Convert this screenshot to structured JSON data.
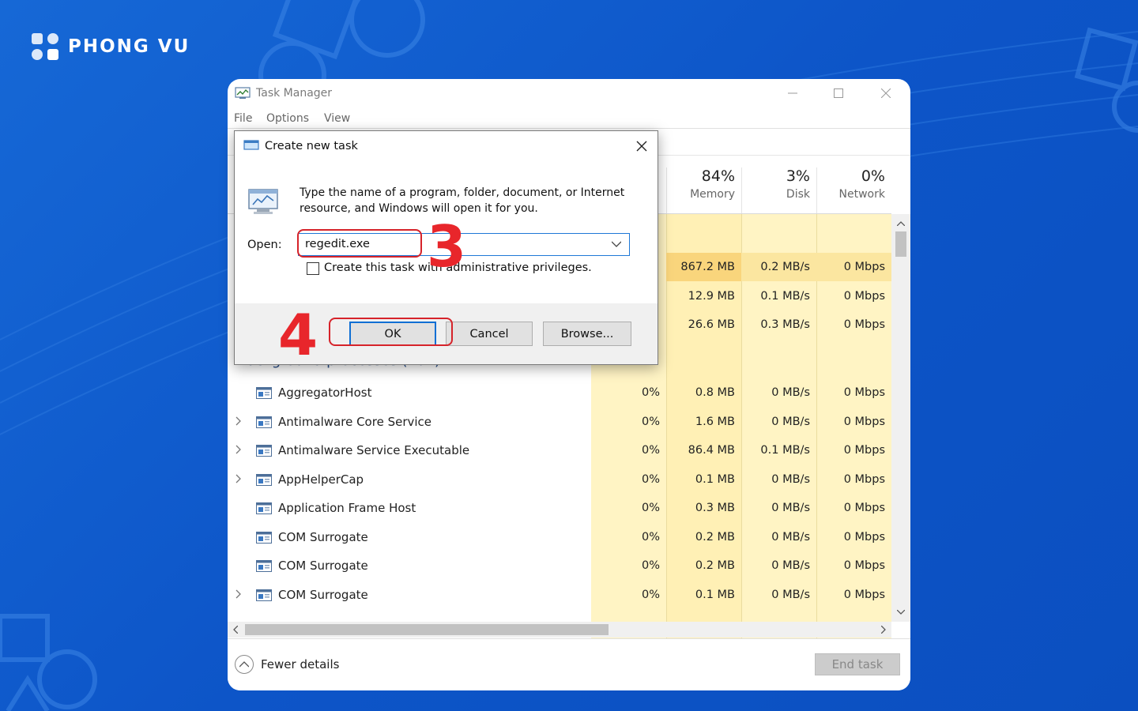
{
  "brand": {
    "name": "PHONG VU"
  },
  "window": {
    "title": "Task Manager",
    "menu": [
      "File",
      "Options",
      "View"
    ]
  },
  "columns": [
    {
      "pct": "84%",
      "name": "Memory"
    },
    {
      "pct": "3%",
      "name": "Disk"
    },
    {
      "pct": "0%",
      "name": "Network"
    }
  ],
  "top_rows": [
    {
      "mem": "867.2 MB",
      "disk": "0.2 MB/s",
      "net": "0 Mbps"
    },
    {
      "mem": "12.9 MB",
      "disk": "0.1 MB/s",
      "net": "0 Mbps"
    },
    {
      "mem": "26.6 MB",
      "disk": "0.3 MB/s",
      "net": "0 Mbps"
    }
  ],
  "section_label": "Background processes (102)",
  "processes": [
    {
      "name": "AggregatorHost",
      "expand": false,
      "cpu": "0%",
      "mem": "0.8 MB",
      "disk": "0 MB/s",
      "net": "0 Mbps"
    },
    {
      "name": "Antimalware Core Service",
      "expand": true,
      "cpu": "0%",
      "mem": "1.6 MB",
      "disk": "0 MB/s",
      "net": "0 Mbps"
    },
    {
      "name": "Antimalware Service Executable",
      "expand": true,
      "cpu": "0%",
      "mem": "86.4 MB",
      "disk": "0.1 MB/s",
      "net": "0 Mbps"
    },
    {
      "name": "AppHelperCap",
      "expand": true,
      "cpu": "0%",
      "mem": "0.1 MB",
      "disk": "0 MB/s",
      "net": "0 Mbps"
    },
    {
      "name": "Application Frame Host",
      "expand": false,
      "cpu": "0%",
      "mem": "0.3 MB",
      "disk": "0 MB/s",
      "net": "0 Mbps"
    },
    {
      "name": "COM Surrogate",
      "expand": false,
      "cpu": "0%",
      "mem": "0.2 MB",
      "disk": "0 MB/s",
      "net": "0 Mbps"
    },
    {
      "name": "COM Surrogate",
      "expand": false,
      "cpu": "0%",
      "mem": "0.2 MB",
      "disk": "0 MB/s",
      "net": "0 Mbps"
    },
    {
      "name": "COM Surrogate",
      "expand": true,
      "cpu": "0%",
      "mem": "0.1 MB",
      "disk": "0 MB/s",
      "net": "0 Mbps"
    }
  ],
  "footer": {
    "fewer_details": "Fewer details",
    "end_task": "End task"
  },
  "dialog": {
    "title": "Create new task",
    "description": "Type the name of a program, folder, document, or Internet resource, and Windows will open it for you.",
    "open_label": "Open:",
    "open_value": "regedit.exe",
    "admin_label": "Create this task with administrative privileges.",
    "ok": "OK",
    "cancel": "Cancel",
    "browse": "Browse..."
  },
  "steps": {
    "input_step": "3",
    "ok_step": "4"
  },
  "colors": {
    "background": "#0d55c8",
    "annotation": "#e8262b",
    "memory_hot": "#f9d57c",
    "column_tint": "#fff4c4"
  }
}
